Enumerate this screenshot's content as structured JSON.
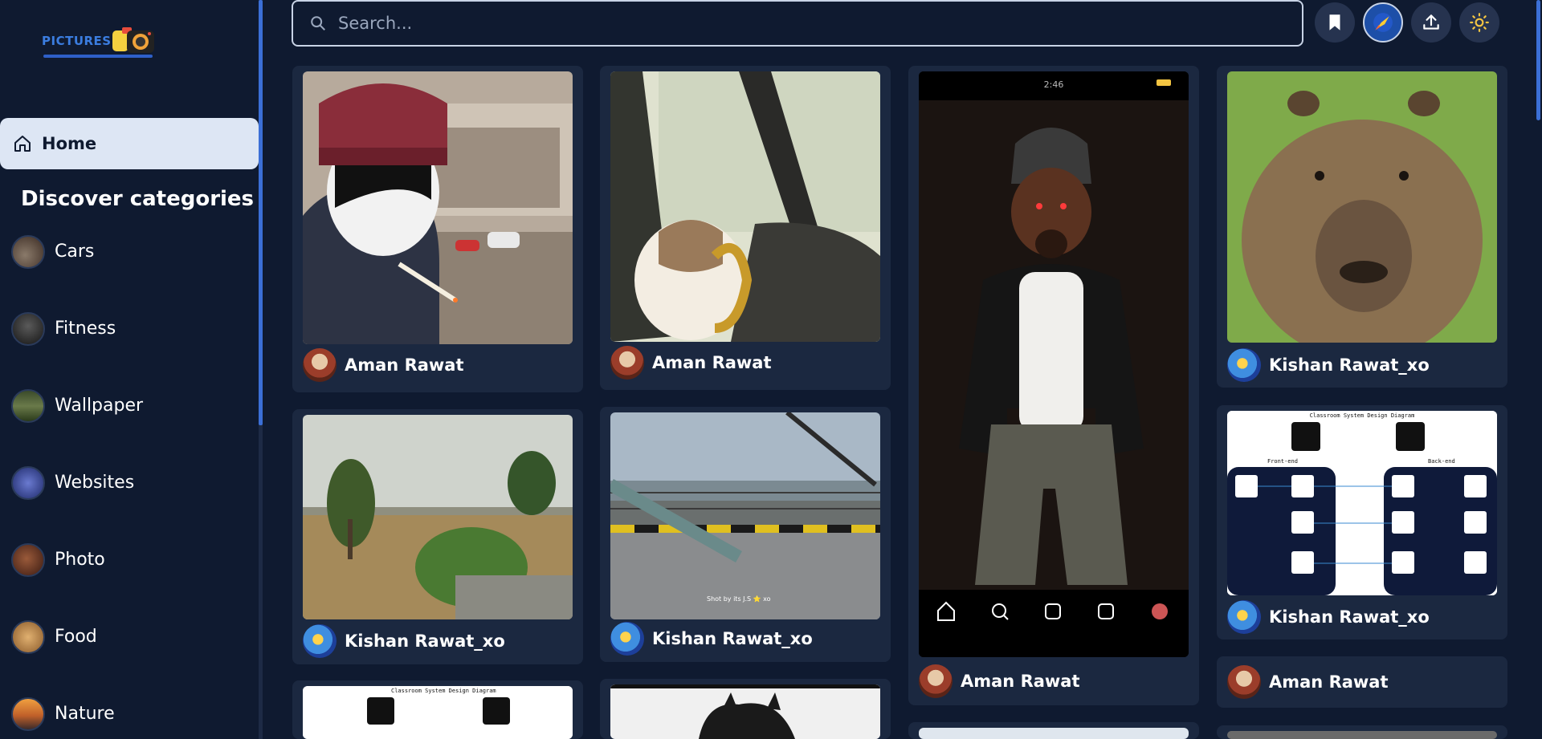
{
  "app": {
    "logo_text": "PICTURES"
  },
  "sidebar": {
    "home_label": "Home",
    "categories_title": "Discover categories",
    "categories": [
      {
        "label": "Cars",
        "thumb_color": "#6b5a4a"
      },
      {
        "label": "Fitness",
        "thumb_color": "#3a3a3a"
      },
      {
        "label": "Wallpaper",
        "thumb_color": "#4a5a3a"
      },
      {
        "label": "Websites",
        "thumb_color": "#2f3f8a"
      },
      {
        "label": "Photo",
        "thumb_color": "#6a3a2a"
      },
      {
        "label": "Food",
        "thumb_color": "#b07a3a"
      },
      {
        "label": "Nature",
        "thumb_color": "#c06a2a"
      }
    ]
  },
  "search": {
    "placeholder": "Search..."
  },
  "toolbar": {
    "icons": [
      "bookmark-icon",
      "profile-avatar",
      "upload-icon",
      "theme-toggle-icon"
    ]
  },
  "feed": {
    "cards": [
      {
        "author": "Aman Rawat",
        "image": "cat smoking in hoodie"
      },
      {
        "author": "Aman Rawat",
        "image": "cat driving car"
      },
      {
        "author": "Aman Rawat",
        "image": "dog in hoodie phone screenshot"
      },
      {
        "author": "Kishan Rawat_xo",
        "image": "capybara portrait"
      },
      {
        "author": "Kishan Rawat_xo",
        "image": "green fields and trees"
      },
      {
        "author": "Kishan Rawat_xo",
        "image": "bridge railing"
      },
      {
        "author": "Kishan Rawat_xo",
        "image": "classroom system design diagram"
      },
      {
        "author": "Aman Rawat",
        "image": ""
      }
    ],
    "photo_watermark": "Shot by its J.S ⭐ xo"
  },
  "phone": {
    "time": "2:46"
  },
  "diagram": {
    "title": "Classroom System Design Diagram",
    "front_label": "Front-end",
    "back_label": "Back-end"
  },
  "colors": {
    "background": "#0f1a30",
    "card": "#1b2840",
    "accent": "#3b6fd6",
    "home_bg": "#dde6f4"
  }
}
